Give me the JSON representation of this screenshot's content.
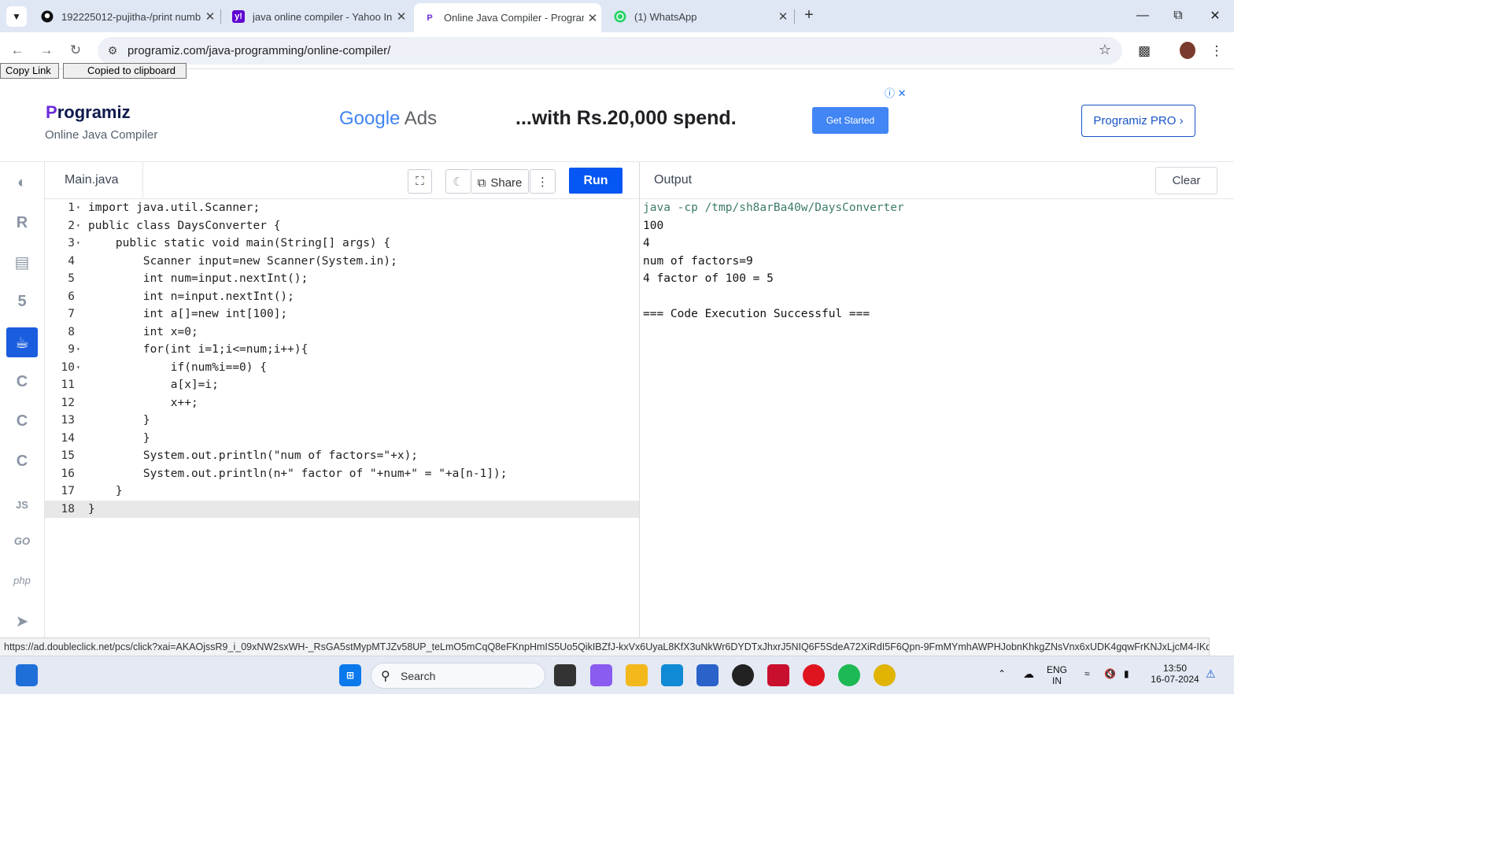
{
  "browser": {
    "tabs": [
      {
        "title": "192225012-pujitha-/print numb",
        "icon": "github-icon",
        "active": false
      },
      {
        "title": "java online compiler - Yahoo In",
        "icon": "yahoo-icon",
        "active": false
      },
      {
        "title": "Online Java Compiler - Program",
        "icon": "programiz-icon",
        "active": true
      },
      {
        "title": "(1) WhatsApp",
        "icon": "whatsapp-icon",
        "active": false
      }
    ],
    "url": "programiz.com/java-programming/online-compiler/"
  },
  "page": {
    "copy_link": "Copy Link",
    "copied": "Copied to clipboard",
    "logo_text": "rogramiz",
    "logo_sub": "Online Java Compiler",
    "ad": {
      "brand_google": "Google",
      "brand_ads": "Ads",
      "text": "...with Rs.20,000 spend.",
      "cta": "Get Started"
    },
    "pro_button": "Programiz PRO ›",
    "languages": [
      "python",
      "r",
      "sql",
      "html",
      "java",
      "c",
      "cpp",
      "csharp",
      "JS",
      "GO",
      "php",
      "swift"
    ],
    "active_language": "java",
    "editor": {
      "file_tab": "Main.java",
      "share_label": "Share",
      "run_label": "Run",
      "lines": [
        {
          "n": "1",
          "fold": true,
          "code": "import java.util.Scanner;"
        },
        {
          "n": "2",
          "fold": true,
          "code": "public class DaysConverter {"
        },
        {
          "n": "3",
          "fold": true,
          "code": "    public static void main(String[] args) {"
        },
        {
          "n": "4",
          "fold": false,
          "code": "        Scanner input=new Scanner(System.in);"
        },
        {
          "n": "5",
          "fold": false,
          "code": "        int num=input.nextInt();"
        },
        {
          "n": "6",
          "fold": false,
          "code": "        int n=input.nextInt();"
        },
        {
          "n": "7",
          "fold": false,
          "code": "        int a[]=new int[100];"
        },
        {
          "n": "8",
          "fold": false,
          "code": "        int x=0;"
        },
        {
          "n": "9",
          "fold": true,
          "code": "        for(int i=1;i<=num;i++){"
        },
        {
          "n": "10",
          "fold": true,
          "code": "            if(num%i==0) {"
        },
        {
          "n": "11",
          "fold": false,
          "code": "            a[x]=i;"
        },
        {
          "n": "12",
          "fold": false,
          "code": "            x++;"
        },
        {
          "n": "13",
          "fold": false,
          "code": "        }"
        },
        {
          "n": "14",
          "fold": false,
          "code": "        }"
        },
        {
          "n": "15",
          "fold": false,
          "code": "        System.out.println(\"num of factors=\"+x);"
        },
        {
          "n": "16",
          "fold": false,
          "code": "        System.out.println(n+\" factor of \"+num+\" = \"+a[n-1]);"
        },
        {
          "n": "17",
          "fold": false,
          "code": "    }"
        },
        {
          "n": "18",
          "fold": false,
          "code": "}"
        }
      ],
      "current_line": "18"
    },
    "output": {
      "title": "Output",
      "clear_label": "Clear",
      "lines": [
        "java -cp /tmp/sh8arBa40w/DaysConverter",
        "100",
        "4",
        "num of factors=9",
        "4 factor of 100 = 5",
        "",
        "=== Code Execution Successful ==="
      ]
    }
  },
  "status_url": "https://ad.doubleclick.net/pcs/click?xai=AKAOjssR9_i_09xNW2sxWH-_RsGA5stMypMTJZv58UP_teLmO5mCqQ8eFKnpHmIS5Uo5QikIBZfJ-kxVx6UyaL8KfX3uNkWr6DYDTxJhxrJ5NIQ6F5SdeA72XiRdI5F6Qpn-9FmMYmhAWPHJobnKhkgZNsVnx6xUDK4gqwFrKNJxLjcM4-IKqvu7npWZ3qU...",
  "taskbar": {
    "search_label": "Search",
    "lang_top": "ENG",
    "lang_bottom": "IN",
    "time": "13:50",
    "date": "16-07-2024"
  },
  "colors": {
    "accent": "#0556f3",
    "tabstrip": "#dfe7f5",
    "active_lang": "#1a5dde",
    "cmd_output": "#3d7a6c"
  }
}
